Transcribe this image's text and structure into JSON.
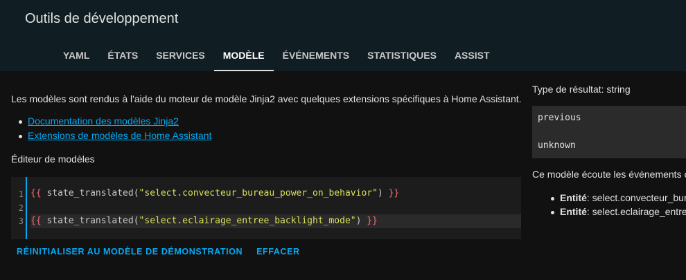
{
  "header": {
    "title": "Outils de développement",
    "tabs": [
      {
        "label": "YAML"
      },
      {
        "label": "ÉTATS"
      },
      {
        "label": "SERVICES"
      },
      {
        "label": "MODÈLE"
      },
      {
        "label": "ÉVÉNEMENTS"
      },
      {
        "label": "STATISTIQUES"
      },
      {
        "label": "ASSIST"
      }
    ],
    "active_tab": "MODÈLE"
  },
  "main": {
    "intro": "Les modèles sont rendus à l'aide du moteur de modèle Jinja2 avec quelques extensions spécifiques à Home Assistant.",
    "links": [
      {
        "label": "Documentation des modèles Jinja2"
      },
      {
        "label": "Extensions de modèles de Home Assistant"
      }
    ],
    "editor_label": "Éditeur de modèles",
    "editor": {
      "line_numbers": [
        "1",
        "2",
        "3"
      ],
      "lines": [
        {
          "open": "{{",
          "fn": " state_translated(",
          "arg": "\"select.convecteur_bureau_power_on_behavior\"",
          "close_paren": ")",
          "close": " }}"
        },
        {
          "open": "",
          "fn": "",
          "arg": "",
          "close_paren": "",
          "close": ""
        },
        {
          "open": "{{",
          "fn": " state_translated(",
          "arg": "\"select.eclairage_entree_backlight_mode\"",
          "close_paren": ")",
          "close": " }}"
        }
      ]
    },
    "buttons": {
      "reset": "RÉINITIALISER AU MODÈLE DE DÉMONSTRATION",
      "clear": "EFFACER"
    }
  },
  "result": {
    "type_label": "Type de résultat: string",
    "output_lines": [
      "previous",
      "unknown"
    ],
    "listens_text": "Ce modèle écoute les événements c",
    "entities": [
      {
        "label": "Entité",
        "value": ": select.convecteur_bure"
      },
      {
        "label": "Entité",
        "value": ": select.eclairage_entree"
      }
    ]
  },
  "colors": {
    "accent": "#03a9f4",
    "header_bg": "#101e24",
    "page_bg": "#111111",
    "brace": "#f26d78",
    "string": "#d9e05a"
  }
}
